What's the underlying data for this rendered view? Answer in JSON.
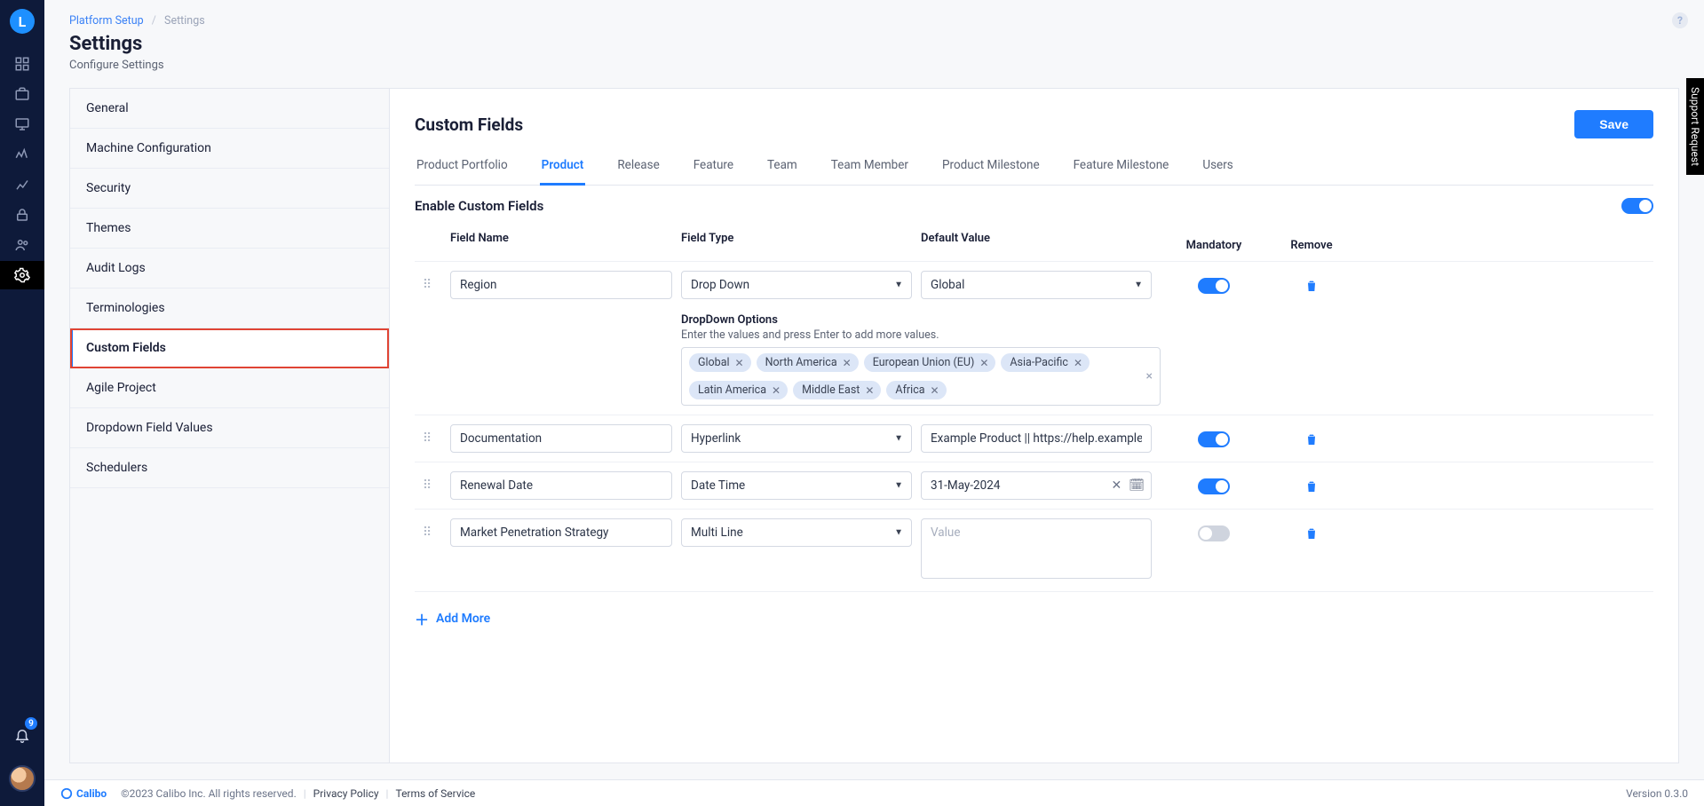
{
  "rail": {
    "logo_letter": "L",
    "badge_count": "9"
  },
  "breadcrumb": {
    "root": "Platform Setup",
    "leaf": "Settings"
  },
  "page": {
    "title": "Settings",
    "subtitle": "Configure Settings"
  },
  "sidebar_items": [
    {
      "label": "General"
    },
    {
      "label": "Machine Configuration"
    },
    {
      "label": "Security"
    },
    {
      "label": "Themes"
    },
    {
      "label": "Audit Logs"
    },
    {
      "label": "Terminologies"
    },
    {
      "label": "Custom Fields",
      "active": true,
      "boxed": true
    },
    {
      "label": "Agile Project"
    },
    {
      "label": "Dropdown Field Values"
    },
    {
      "label": "Schedulers"
    }
  ],
  "panel": {
    "title": "Custom Fields",
    "save_label": "Save",
    "tabs": [
      "Product Portfolio",
      "Product",
      "Release",
      "Feature",
      "Team",
      "Team Member",
      "Product Milestone",
      "Feature Milestone",
      "Users"
    ],
    "active_tab": "Product",
    "enable_label": "Enable Custom Fields",
    "columns": {
      "name": "Field Name",
      "type": "Field Type",
      "default": "Default Value",
      "mandatory": "Mandatory",
      "remove": "Remove"
    },
    "dropdown_section": {
      "label": "DropDown Options",
      "hint": "Enter the values and press Enter to add more values."
    },
    "rows": [
      {
        "name": "Region",
        "type": "Drop Down",
        "default": "Global",
        "mandatory": true,
        "options": [
          "Global",
          "North America",
          "European Union (EU)",
          "Asia-Pacific",
          "Latin America",
          "Middle East",
          "Africa"
        ]
      },
      {
        "name": "Documentation",
        "type": "Hyperlink",
        "default": "Example Product || https://help.example.com",
        "mandatory": true
      },
      {
        "name": "Renewal Date",
        "type": "Date Time",
        "default": "31-May-2024",
        "mandatory": true
      },
      {
        "name": "Market Penetration Strategy",
        "type": "Multi Line",
        "default_placeholder": "Value",
        "mandatory": false
      }
    ],
    "add_more": "Add More"
  },
  "footer": {
    "brand": "Calibo",
    "copyright": "©2023 Calibo Inc. All rights reserved.",
    "privacy": "Privacy Policy",
    "terms": "Terms of Service",
    "version": "Version 0.3.0"
  },
  "support_tab": "Support Request"
}
